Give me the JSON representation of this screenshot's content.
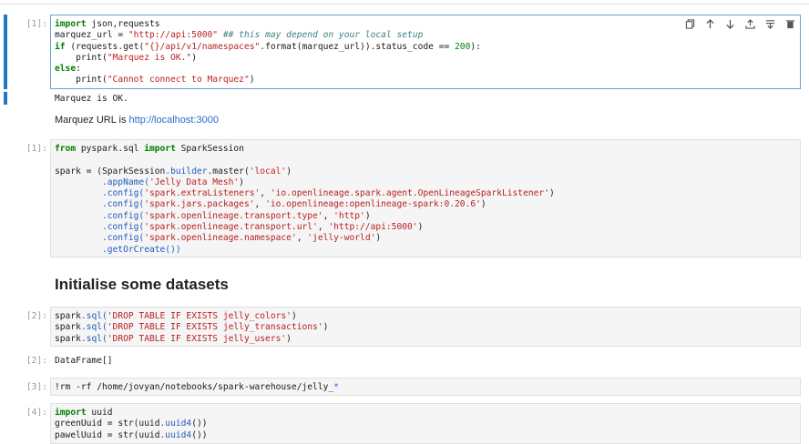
{
  "cells": [
    {
      "prompt": "[1]:",
      "lines": [
        [
          {
            "t": "import",
            "c": "kw"
          },
          {
            "t": " json,requests"
          }
        ],
        [
          {
            "t": "marquez_url "
          },
          {
            "t": "="
          },
          {
            "t": " "
          },
          {
            "t": "\"http://api:5000\"",
            "c": "str"
          },
          {
            "t": " "
          },
          {
            "t": "## this may depend on your local setup",
            "c": "cm"
          }
        ],
        [
          {
            "t": "if",
            "c": "kw"
          },
          {
            "t": " (requests"
          },
          {
            "t": ".get",
            "c": ""
          },
          {
            "t": "("
          },
          {
            "t": "\"{}/api/v1/namespaces\"",
            "c": "str"
          },
          {
            "t": ".format(marquez_url))"
          },
          {
            "t": ".status_code"
          },
          {
            "t": " "
          },
          {
            "t": "=="
          },
          {
            "t": " "
          },
          {
            "t": "200",
            "c": "num"
          },
          {
            "t": "):"
          }
        ],
        [
          {
            "t": "    print("
          },
          {
            "t": "\"Marquez is OK.\"",
            "c": "str"
          },
          {
            "t": ")"
          }
        ],
        [
          {
            "t": "else",
            "c": "kw"
          },
          {
            "t": ":"
          }
        ],
        [
          {
            "t": "    print("
          },
          {
            "t": "\"Cannot connect to Marquez\"",
            "c": "str"
          },
          {
            "t": ")"
          }
        ]
      ]
    },
    {
      "prompt": "[1]:",
      "lines": [
        [
          {
            "t": "from",
            "c": "kw"
          },
          {
            "t": " pyspark.sql "
          },
          {
            "t": "import",
            "c": "kw"
          },
          {
            "t": " SparkSession"
          }
        ],
        [
          {
            "t": ""
          }
        ],
        [
          {
            "t": "spark "
          },
          {
            "t": "="
          },
          {
            "t": " (SparkSession"
          },
          {
            "t": ".builder",
            "c": "attr"
          },
          {
            "t": ".master("
          },
          {
            "t": "'local'",
            "c": "str"
          },
          {
            "t": ")"
          }
        ],
        [
          {
            "t": "         "
          },
          {
            "t": ".appName(",
            "c": "attr"
          },
          {
            "t": "'Jelly Data Mesh'",
            "c": "str"
          },
          {
            "t": ")"
          }
        ],
        [
          {
            "t": "         "
          },
          {
            "t": ".config(",
            "c": "attr"
          },
          {
            "t": "'spark.extraListeners'",
            "c": "str"
          },
          {
            "t": ", "
          },
          {
            "t": "'io.openlineage.spark.agent.OpenLineageSparkListener'",
            "c": "str"
          },
          {
            "t": ")"
          }
        ],
        [
          {
            "t": "         "
          },
          {
            "t": ".config(",
            "c": "attr"
          },
          {
            "t": "'spark.jars.packages'",
            "c": "str"
          },
          {
            "t": ", "
          },
          {
            "t": "'io.openlineage:openlineage-spark:0.20.6'",
            "c": "str"
          },
          {
            "t": ")"
          }
        ],
        [
          {
            "t": "         "
          },
          {
            "t": ".config(",
            "c": "attr"
          },
          {
            "t": "'spark.openlineage.transport.type'",
            "c": "str"
          },
          {
            "t": ", "
          },
          {
            "t": "'http'",
            "c": "str"
          },
          {
            "t": ")"
          }
        ],
        [
          {
            "t": "         "
          },
          {
            "t": ".config(",
            "c": "attr"
          },
          {
            "t": "'spark.openlineage.transport.url'",
            "c": "str"
          },
          {
            "t": ", "
          },
          {
            "t": "'http://api:5000'",
            "c": "str"
          },
          {
            "t": ")"
          }
        ],
        [
          {
            "t": "         "
          },
          {
            "t": ".config(",
            "c": "attr"
          },
          {
            "t": "'spark.openlineage.namespace'",
            "c": "str"
          },
          {
            "t": ", "
          },
          {
            "t": "'jelly-world'",
            "c": "str"
          },
          {
            "t": ")"
          }
        ],
        [
          {
            "t": "         "
          },
          {
            "t": ".getOrCreate())",
            "c": "attr"
          }
        ]
      ]
    },
    {
      "prompt": "[2]:",
      "lines": [
        [
          {
            "t": "spark"
          },
          {
            "t": ".sql(",
            "c": "attr"
          },
          {
            "t": "'DROP TABLE IF EXISTS jelly_colors'",
            "c": "str"
          },
          {
            "t": ")"
          }
        ],
        [
          {
            "t": "spark"
          },
          {
            "t": ".sql(",
            "c": "attr"
          },
          {
            "t": "'DROP TABLE IF EXISTS jelly_transactions'",
            "c": "str"
          },
          {
            "t": ")"
          }
        ],
        [
          {
            "t": "spark"
          },
          {
            "t": ".sql(",
            "c": "attr"
          },
          {
            "t": "'DROP TABLE IF EXISTS jelly_users'",
            "c": "str"
          },
          {
            "t": ")"
          }
        ]
      ]
    },
    {
      "prompt": "[3]:",
      "lines": [
        [
          {
            "t": "!rm -rf /home/jovyan/notebooks/spark-warehouse/jelly_"
          },
          {
            "t": "*",
            "c": "star"
          }
        ]
      ]
    },
    {
      "prompt": "[4]:",
      "lines": [
        [
          {
            "t": "import",
            "c": "kw"
          },
          {
            "t": " uuid"
          }
        ],
        [
          {
            "t": "greenUuid "
          },
          {
            "t": "="
          },
          {
            "t": " str(uuid"
          },
          {
            "t": ".uuid4",
            "c": "attr"
          },
          {
            "t": "())"
          }
        ],
        [
          {
            "t": "pawelUuid "
          },
          {
            "t": "="
          },
          {
            "t": " str(uuid"
          },
          {
            "t": ".uuid4",
            "c": "attr"
          },
          {
            "t": "())"
          }
        ]
      ]
    }
  ],
  "outputs": {
    "cell1_stdout": "Marquez is OK.",
    "marquez_url_prefix": "Marquez URL is ",
    "marquez_url_link": "http://localhost:3000",
    "cell3_prompt": "[2]:",
    "cell3_result": "DataFrame[]"
  },
  "heading": "Initialise some datasets",
  "toolbar": {
    "icons": [
      "copy-icon",
      "move-up-icon",
      "move-down-icon",
      "insert-above-icon",
      "insert-below-icon",
      "delete-icon"
    ]
  },
  "colors": {
    "active_bar": "#1e78c8",
    "active_border": "#6aa0d6",
    "link": "#2a6ccb"
  }
}
